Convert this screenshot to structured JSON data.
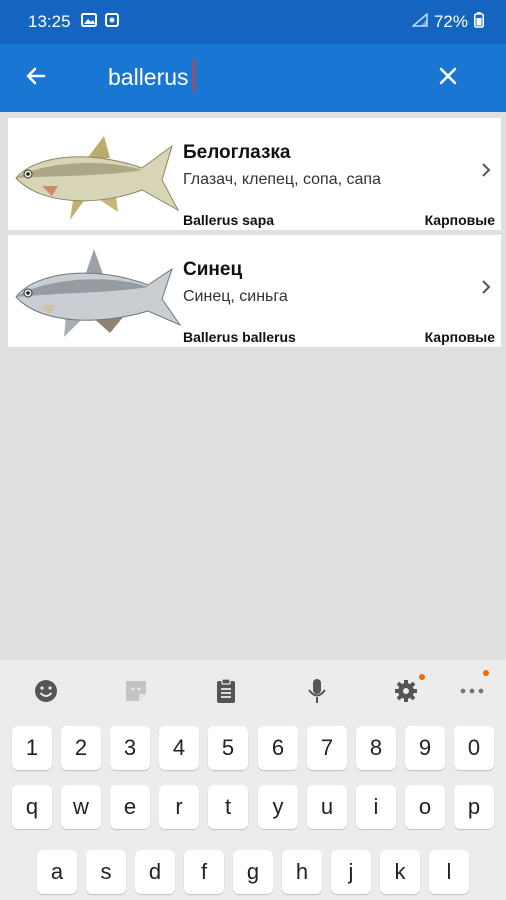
{
  "status_bar": {
    "time": "13:25",
    "battery": "72%",
    "left_icons": [
      "image-icon",
      "notification-icon"
    ],
    "right_icons": [
      "signal-icon",
      "battery-icon"
    ]
  },
  "toolbar": {
    "back_icon": "arrow-back-icon",
    "search_value": "ballerus",
    "clear_icon": "close-icon",
    "color": "#1976d2",
    "status_color": "#1565c0"
  },
  "results": [
    {
      "name": "Белоглазка",
      "aliases": "Глазач, клепец, сопа, сапа",
      "latin": "Ballerus sapa",
      "family": "Карповые",
      "icon": "fish-image"
    },
    {
      "name": "Синец",
      "aliases": "Синец, синьга",
      "latin": "Ballerus ballerus",
      "family": "Карповые",
      "icon": "fish-image"
    }
  ],
  "keyboard": {
    "tools": [
      "emoji-icon",
      "sticker-icon",
      "clipboard-icon",
      "mic-icon",
      "settings-icon",
      "more-icon"
    ],
    "number_row": [
      "1",
      "2",
      "3",
      "4",
      "5",
      "6",
      "7",
      "8",
      "9",
      "0"
    ],
    "row_q": [
      "q",
      "w",
      "e",
      "r",
      "t",
      "y",
      "u",
      "i",
      "o",
      "p"
    ],
    "row_a": [
      "a",
      "s",
      "d",
      "f",
      "g",
      "h",
      "j",
      "k",
      "l"
    ],
    "accent_dot": "#ef6c00"
  }
}
